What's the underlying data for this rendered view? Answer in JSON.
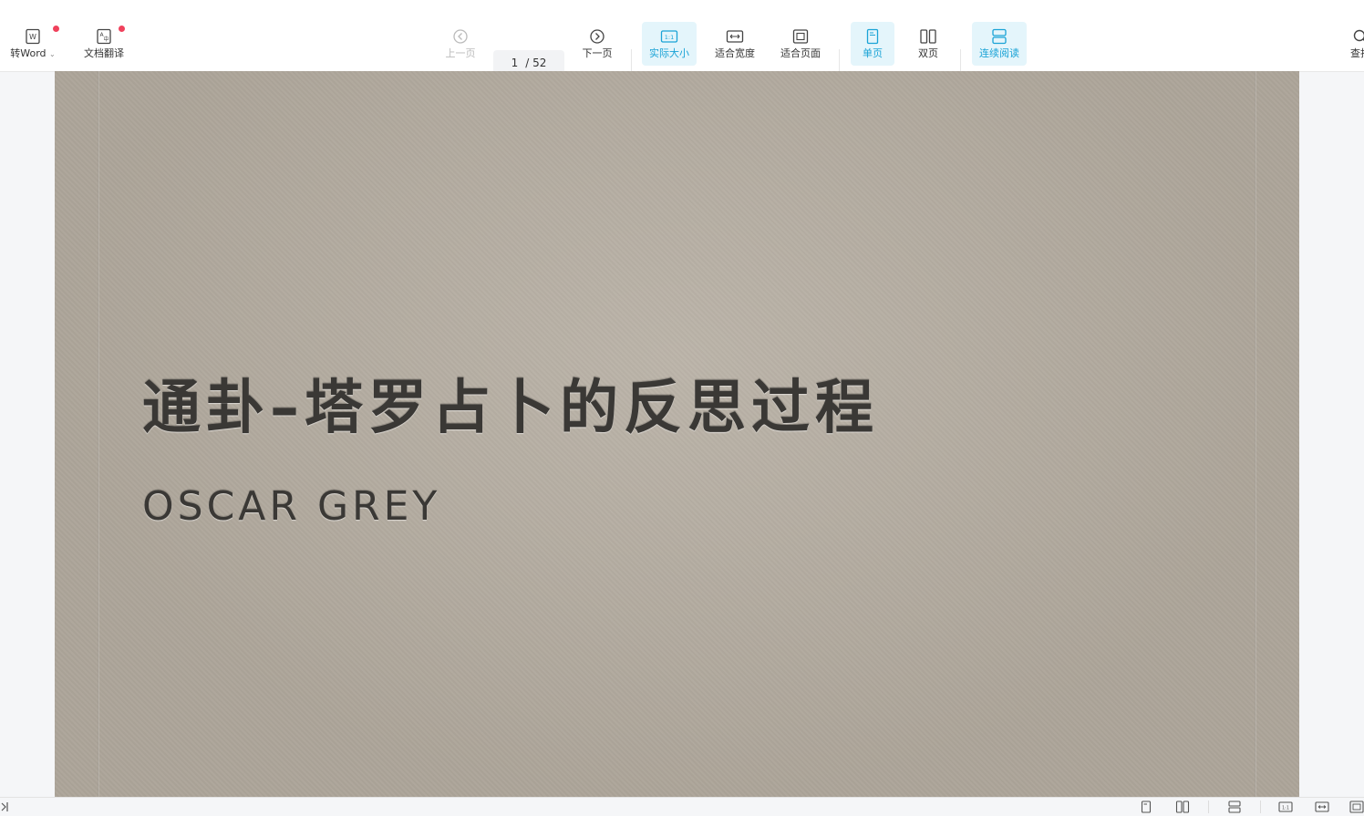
{
  "toolbar": {
    "to_word_label": "转Word",
    "translate_label": "文档翻译",
    "prev_label": "上一页",
    "current_page": "1",
    "total_pages": "/ 52",
    "next_label": "下一页",
    "actual_size_label": "实际大小",
    "fit_width_label": "适合宽度",
    "fit_page_label": "适合页面",
    "single_page_label": "单页",
    "double_page_label": "双页",
    "continuous_label": "连续阅读",
    "search_label": "查找"
  },
  "slide": {
    "title": "通卦–塔罗占卜的反思过程",
    "subtitle": "OSCAR GREY"
  },
  "colors": {
    "accent": "#1aa3d6",
    "accent_bg": "#e4f5fb",
    "badge": "#f0415c",
    "page_bg": "#b4aca0"
  }
}
